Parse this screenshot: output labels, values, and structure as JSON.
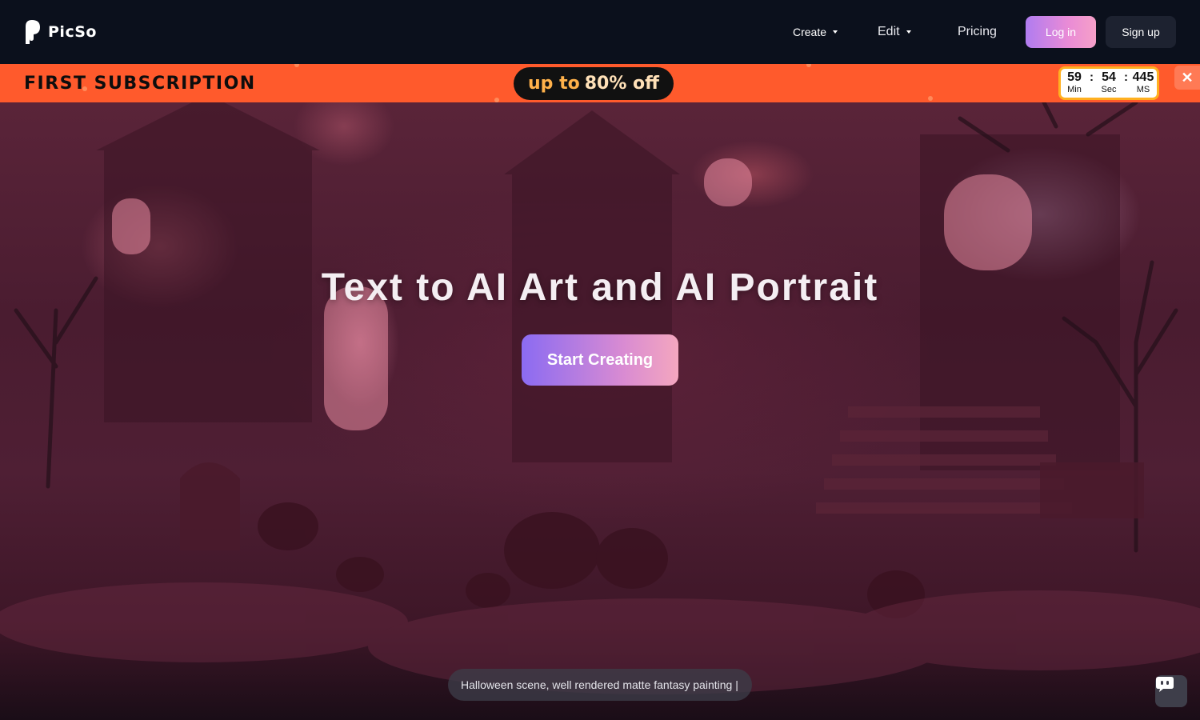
{
  "header": {
    "brand": "PicSo",
    "nav": {
      "create": "Create",
      "edit": "Edit",
      "pricing": "Pricing"
    },
    "login_label": "Log in",
    "signup_label": "Sign up"
  },
  "promo": {
    "title": "FIRST SUBSCRIPTION",
    "pill_prefix": "up to",
    "pill_value": "80% off",
    "timer": {
      "min": "59",
      "sec": "54",
      "ms": "445",
      "min_label": "Min",
      "sec_label": "Sec",
      "ms_label": "MS",
      "separator": ":"
    },
    "close_glyph": "✕"
  },
  "hero": {
    "title": "Text to AI Art and AI Portrait",
    "cta_label": "Start Creating",
    "prompt_text": "Halloween scene, well rendered matte fantasy painting |"
  },
  "colors": {
    "header_bg": "#0b101c",
    "promo_bg": "#ff5a2c",
    "accent_gradient_start": "#8b6bf2",
    "accent_gradient_end": "#f4a7bf",
    "timer_border": "#ffb020"
  }
}
